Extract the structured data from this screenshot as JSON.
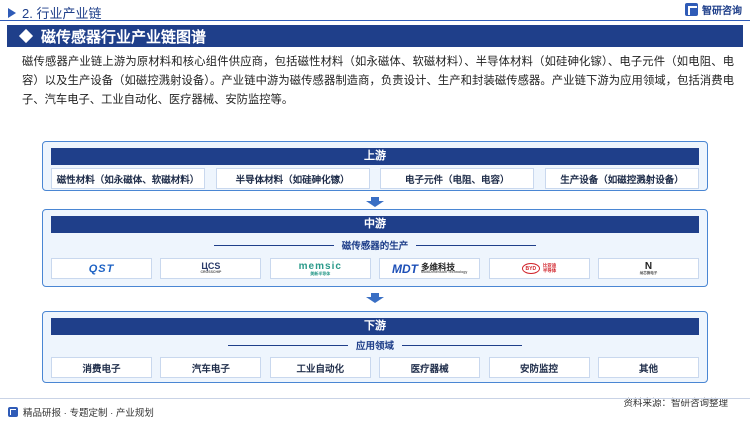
{
  "header": {
    "section_title": "2. 行业产业链",
    "brand_name": "智研咨询"
  },
  "banner": {
    "title": "磁传感器行业产业链图谱"
  },
  "intro": "磁传感器产业链上游为原材料和核心组件供应商，包括磁性材料（如永磁体、软磁材料）、半导体材料（如硅砷化镓）、电子元件（如电阻、电容）以及生产设备（如磁控溅射设备）。产业链中游为磁传感器制造商，负责设计、生产和封装磁传感器。产业链下游为应用领域，包括消费电子、汽车电子、工业自动化、医疗器械、安防监控等。",
  "upstream": {
    "title": "上游",
    "items": [
      "磁性材料（如永磁体、软磁材料）",
      "半导体材料（如硅砷化镓）",
      "电子元件（电阻、电容）",
      "生产设备（如磁控溅射设备）"
    ]
  },
  "midstream": {
    "title": "中游",
    "subtitle": "磁传感器的生产",
    "logos": {
      "qst": "QST",
      "crosschip_mark": "ЦCS",
      "crosschip_sub": "CROSSCHIP",
      "memsic_mark": "memsic",
      "memsic_sub": "美新半导体",
      "mdt_mark": "MDT",
      "mdt_name": "多维科技",
      "mdt_sub": "MultiDimension Technology",
      "byd_mark": "BYD",
      "byd_line1": "比亚迪",
      "byd_line2": "半导体",
      "nv_mark": "N",
      "nv_sub": "纳芯微电子"
    }
  },
  "downstream": {
    "title": "下游",
    "subtitle": "应用领域",
    "items": [
      "消费电子",
      "汽车电子",
      "工业自动化",
      "医疗器械",
      "安防监控",
      "其他"
    ]
  },
  "footer": {
    "left": "精品研报 · 专题定制 · 产业规划",
    "source": "资料来源：智研咨询整理"
  },
  "colors": {
    "primary": "#1f3f8a",
    "accent": "#4a86d3",
    "panel": "#eef5fd"
  }
}
